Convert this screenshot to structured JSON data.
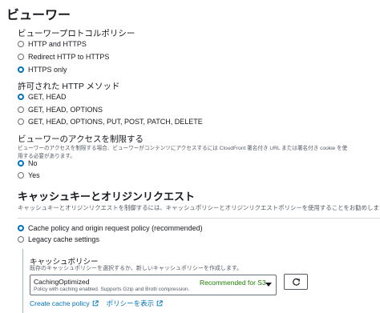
{
  "viewer": {
    "title": "ビューワー",
    "protocol": {
      "label": "ビューワープロトコルポリシー",
      "options": [
        "HTTP and HTTPS",
        "Redirect HTTP to HTTPS",
        "HTTPS only"
      ],
      "selected": "HTTPS only"
    },
    "methods": {
      "label": "許可された HTTP メソッド",
      "options": [
        "GET, HEAD",
        "GET, HEAD, OPTIONS",
        "GET, HEAD, OPTIONS, PUT, POST, PATCH, DELETE"
      ],
      "selected": "GET, HEAD"
    },
    "restrict": {
      "label": "ビューワーのアクセスを制限する",
      "desc_line1": "ビューワーのアクセスを制限する場合、ビューワーがコンテンツにアクセスするには CloudFront 署名付き URL または署名付き cookie を使",
      "desc_line2": "用する必要があります。",
      "options": [
        "No",
        "Yes"
      ],
      "selected": "No"
    }
  },
  "cache": {
    "title": "キャッシュキーとオリジンリクエスト",
    "desc": "キャッシュキーとオリジンリクエストを制御するには、キャッシュポリシーとオリジンリクエストポリシーを使用することをお勧めします。",
    "options": [
      "Cache policy and origin request policy (recommended)",
      "Legacy cache settings"
    ],
    "selected": "Cache policy and origin request policy (recommended)",
    "policy": {
      "label": "キャッシュポリシー",
      "desc": "既存のキャッシュポリシーを選択するか、新しいキャッシュポリシーを作成します。",
      "select_value": "CachingOptimized",
      "select_desc": "Policy with caching enabled. Supports Gzip and Brotli compression.",
      "badge": "Recommended for S3",
      "create_link": "Create cache policy",
      "view_link": "ポリシーを表示"
    }
  },
  "colors": {
    "accent": "#0073bb",
    "recommended": "#1d8102",
    "text": "#16191f",
    "muted": "#545b64"
  },
  "icons": [
    "radio-icon",
    "chevron-down-icon",
    "refresh-icon",
    "external-link-icon"
  ]
}
